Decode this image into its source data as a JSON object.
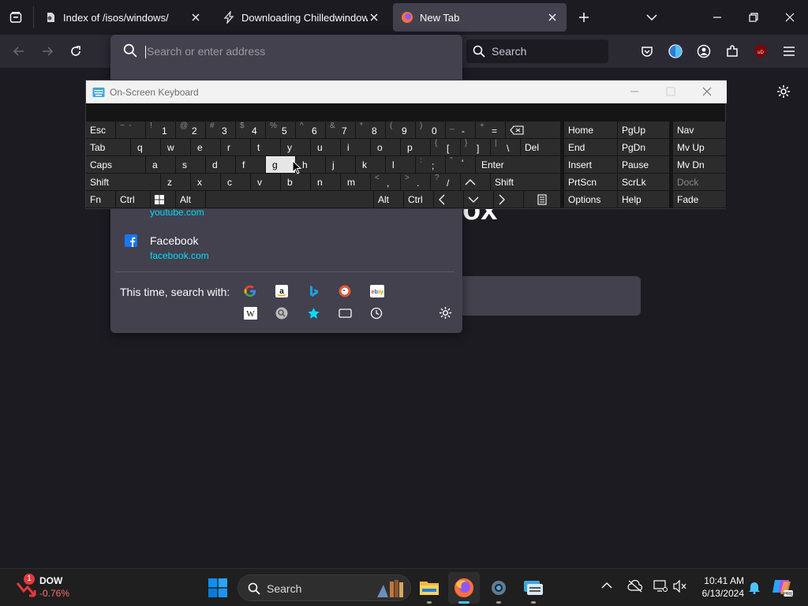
{
  "browser": {
    "tabs": [
      {
        "title": "Index of /isos/windows/",
        "selected": false
      },
      {
        "title": "Downloading Chilledwindows.e",
        "selected": false
      },
      {
        "title": "New Tab",
        "selected": true
      }
    ],
    "address_placeholder": "Search or enter address",
    "search_placeholder": "Search"
  },
  "dropdown": {
    "results": [
      {
        "title": "",
        "url": "youtube.com"
      },
      {
        "title": "Facebook",
        "url": "facebook.com"
      }
    ],
    "search_with_label": "This time, search with:"
  },
  "newtab": {
    "brand_fragment": "ox"
  },
  "osk": {
    "title": "On-Screen Keyboard",
    "rows": {
      "r1": [
        {
          "shift": "~",
          "main": "`"
        },
        {
          "shift": "!",
          "main": "1"
        },
        {
          "shift": "@",
          "main": "2"
        },
        {
          "shift": "#",
          "main": "3"
        },
        {
          "shift": "$",
          "main": "4"
        },
        {
          "shift": "%",
          "main": "5"
        },
        {
          "shift": "^",
          "main": "6"
        },
        {
          "shift": "&",
          "main": "7"
        },
        {
          "shift": "*",
          "main": "8"
        },
        {
          "shift": "(",
          "main": "9"
        },
        {
          "shift": ")",
          "main": "0"
        },
        {
          "shift": "_",
          "main": "-"
        },
        {
          "shift": "+",
          "main": "="
        }
      ],
      "r2": [
        "q",
        "w",
        "e",
        "r",
        "t",
        "y",
        "u",
        "i",
        "o",
        "p"
      ],
      "r2_brackets": [
        {
          "shift": "{",
          "main": "["
        },
        {
          "shift": "}",
          "main": "]"
        },
        {
          "shift": "|",
          "main": "\\"
        }
      ],
      "r3": [
        "a",
        "s",
        "d",
        "f",
        "g",
        "h",
        "j",
        "k",
        "l"
      ],
      "r3_punct": [
        {
          "shift": ":",
          "main": ";"
        },
        {
          "shift": "\"",
          "main": "'"
        }
      ],
      "r4": [
        "z",
        "x",
        "c",
        "v",
        "b",
        "n",
        "m"
      ],
      "r4_punct": [
        {
          "shift": "<",
          "main": ","
        },
        {
          "shift": ">",
          "main": "."
        },
        {
          "shift": "?",
          "main": "/"
        }
      ]
    },
    "labels": {
      "esc": "Esc",
      "tab": "Tab",
      "caps": "Caps",
      "shift": "Shift",
      "fn": "Fn",
      "ctrl": "Ctrl",
      "alt": "Alt",
      "del": "Del",
      "enter": "Enter",
      "shift_r": "Shift",
      "alt_r": "Alt",
      "ctrl_r": "Ctrl"
    },
    "nav": [
      [
        "Home",
        "PgUp",
        "Nav"
      ],
      [
        "End",
        "PgDn",
        "Mv Up"
      ],
      [
        "Insert",
        "Pause",
        "Mv Dn"
      ],
      [
        "PrtScn",
        "ScrLk",
        "Dock"
      ],
      [
        "Options",
        "Help",
        "Fade"
      ]
    ],
    "highlighted_key": "g"
  },
  "taskbar": {
    "stock_name": "DOW",
    "stock_change": "-0.76%",
    "stock_badge": "1",
    "search_label": "Search",
    "time": "10:41 AM",
    "date": "6/13/2024"
  },
  "colors": {
    "accent": "#00ddff",
    "tab_selected": "#42414d",
    "toolbar": "#2b2a33",
    "ubo": "#800000"
  }
}
